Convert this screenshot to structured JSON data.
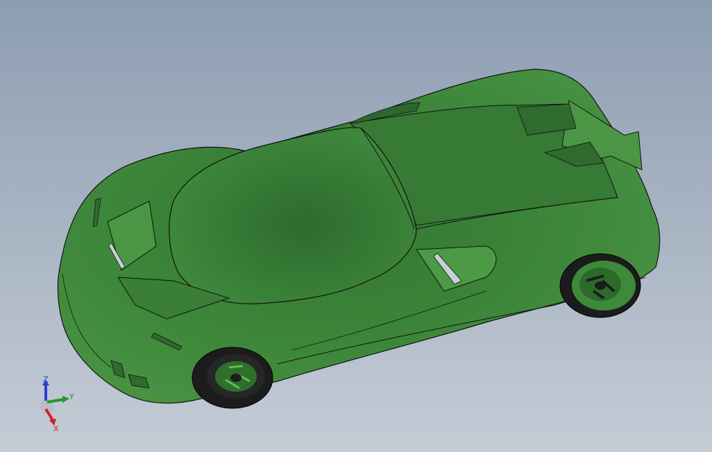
{
  "viewport": {
    "background_top": "#8d9db2",
    "background_bottom": "#c4ccd6"
  },
  "model": {
    "body_color": "#3f8a3d",
    "body_dark": "#2f6a2e",
    "edge_color": "#111111",
    "tire_color": "#1c1c1c",
    "wheel_color": "#2f6f2b"
  },
  "triad": {
    "z_label": "Z",
    "y_label": "Y",
    "x_label": "X",
    "z_color": "#2a3fd0",
    "y_color": "#1f9a2a",
    "x_color": "#cc2222"
  }
}
